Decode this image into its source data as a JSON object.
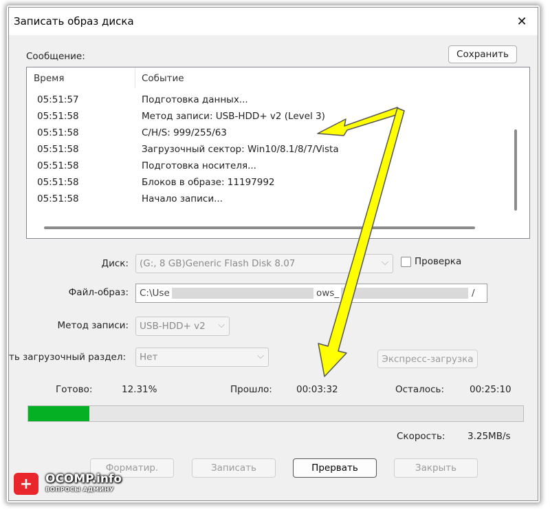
{
  "window": {
    "title": "Записать образ диска",
    "close_glyph": "✕"
  },
  "message_label": "Сообщение:",
  "save_button": "Сохранить",
  "log": {
    "columns": [
      "Время",
      "Событие"
    ],
    "rows": [
      {
        "time": "05:51:57",
        "event": "Подготовка данных..."
      },
      {
        "time": "05:51:58",
        "event": "Метод записи: USB-HDD+ v2 (Level 3)"
      },
      {
        "time": "05:51:58",
        "event": "C/H/S: 999/255/63"
      },
      {
        "time": "05:51:58",
        "event": "Загрузочный сектор: Win10/8.1/8/7/Vista"
      },
      {
        "time": "05:51:58",
        "event": "Подготовка носителя..."
      },
      {
        "time": "05:51:58",
        "event": "Блоков в образе: 11197992"
      },
      {
        "time": "05:51:58",
        "event": "Начало записи..."
      }
    ]
  },
  "disk": {
    "label": "Диск:",
    "value": "(G:, 8 GB)Generic Flash Disk     8.07",
    "verify_label": "Проверка"
  },
  "image_file": {
    "label": "Файл-образ:",
    "value_start": "C:\\Use",
    "value_mid": "ows_",
    "value_end": "/"
  },
  "write_method": {
    "label": "Метод записи:",
    "value": "USB-HDD+ v2"
  },
  "boot_partition": {
    "label": "ть загрузочный раздел:",
    "value": "Нет",
    "express_button": "Экспресс-загрузка"
  },
  "status": {
    "ready_label": "Готово:",
    "ready_value": "12.31%",
    "elapsed_label": "Прошло:",
    "elapsed_value": "00:03:32",
    "remaining_label": "Осталось:",
    "remaining_value": "00:25:10",
    "speed_label": "Скорость:",
    "speed_value": "3.25MB/s",
    "progress": 0.1231
  },
  "buttons": {
    "format": "Форматир.",
    "write": "Записать",
    "abort": "Прервать",
    "close": "Закрыть"
  },
  "watermark": {
    "badge": "+",
    "name": "OCOMP.info",
    "tagline": "ВОПРОСЫ АДМИНУ"
  },
  "colors": {
    "progress_fill": "#06b025",
    "arrow": "#ffff00",
    "logo_red": "#e8262b"
  }
}
